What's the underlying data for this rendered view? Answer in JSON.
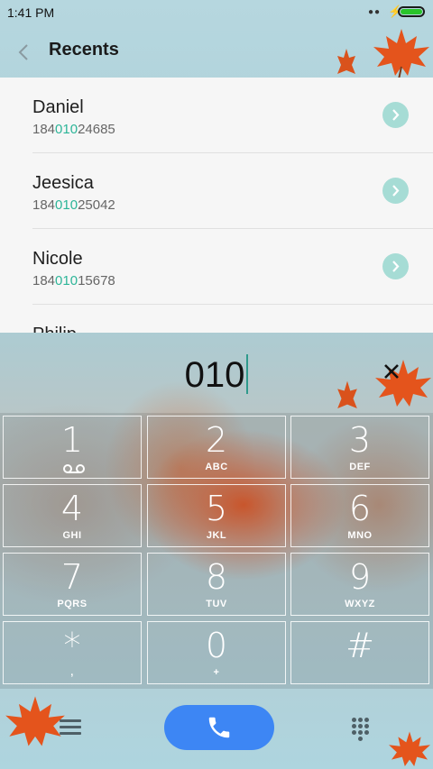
{
  "status_bar": {
    "time": "1:41 PM"
  },
  "header": {
    "title": "Recents"
  },
  "recents": [
    {
      "name": "Daniel",
      "number_prefix": "184",
      "number_match": "010",
      "number_suffix": "24685"
    },
    {
      "name": "Jeesica",
      "number_prefix": "184",
      "number_match": "010",
      "number_suffix": "25042"
    },
    {
      "name": "Nicole",
      "number_prefix": "184",
      "number_match": "010",
      "number_suffix": "15678"
    },
    {
      "name": "Philip"
    }
  ],
  "dialer": {
    "input": "010"
  },
  "keypad": [
    {
      "digit": "1",
      "letters": ""
    },
    {
      "digit": "2",
      "letters": "ABC"
    },
    {
      "digit": "3",
      "letters": "DEF"
    },
    {
      "digit": "4",
      "letters": "GHI"
    },
    {
      "digit": "5",
      "letters": "JKL"
    },
    {
      "digit": "6",
      "letters": "MNO"
    },
    {
      "digit": "7",
      "letters": "PQRS"
    },
    {
      "digit": "8",
      "letters": "TUV"
    },
    {
      "digit": "9",
      "letters": "WXYZ"
    },
    {
      "digit": "*",
      "letters": ","
    },
    {
      "digit": "0",
      "letters": "+"
    },
    {
      "digit": "#",
      "letters": ""
    }
  ],
  "colors": {
    "accent": "#2db598",
    "call_button": "#3d86f4",
    "battery": "#29c42a",
    "detail_button": "#a6dcd5"
  },
  "icons": {
    "back": "chevron-left-icon",
    "detail": "chevron-right-icon",
    "delete": "close-icon",
    "voicemail": "voicemail-icon",
    "menu": "menu-icon",
    "call": "phone-icon",
    "keypad": "dialpad-icon"
  }
}
